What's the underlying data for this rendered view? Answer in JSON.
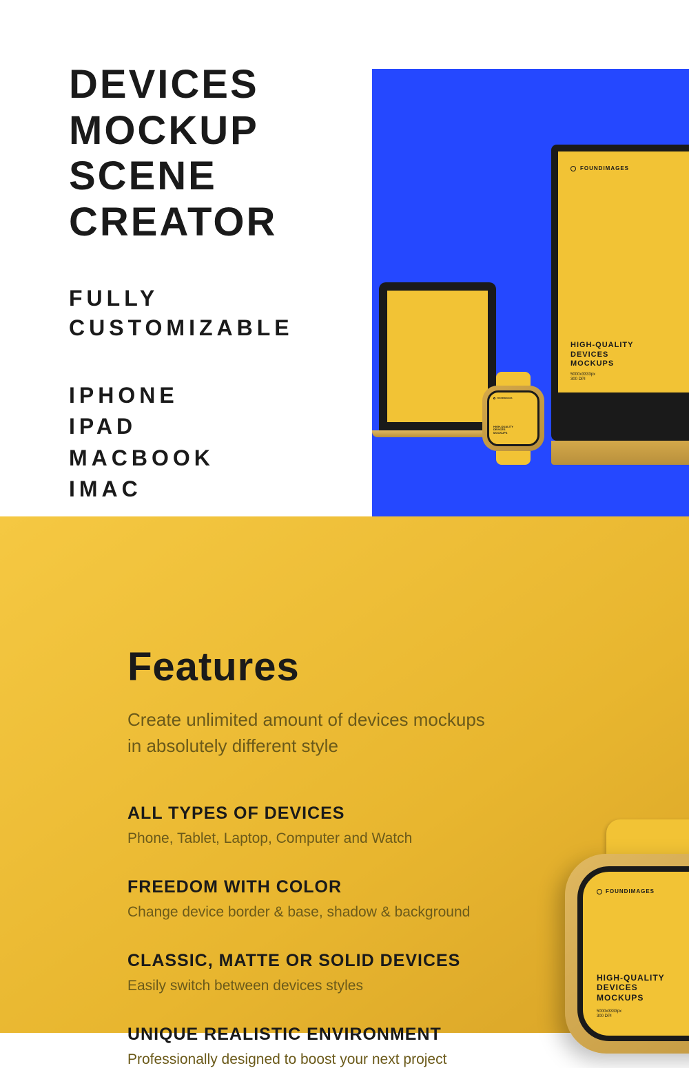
{
  "hero": {
    "title_line1": "DEVICES",
    "title_line2": "MOCKUP",
    "title_line3": "SCENE",
    "title_line4": "CREATOR",
    "subtitle_line1": "FULLY",
    "subtitle_line2": "CUSTOMIZABLE",
    "devices": [
      "IPHONE",
      "IPAD",
      "MACBOOK",
      "IMAC"
    ]
  },
  "brand": "FOUNDIMAGES",
  "screen_content": {
    "title_line1": "HIGH-QUALITY",
    "title_line2": "DEVICES",
    "title_line3": "MOCKUPS",
    "meta_line1": "5000x3333px",
    "meta_line2": "300 DPI"
  },
  "features": {
    "title": "Features",
    "subtitle_line1": "Create unlimited amount of devices mockups",
    "subtitle_line2": "in absolutely different style",
    "items": [
      {
        "heading": "ALL TYPES OF DEVICES",
        "desc": "Phone, Tablet, Laptop, Computer and Watch"
      },
      {
        "heading": "FREEDOM WITH COLOR",
        "desc": "Change device border & base, shadow & background"
      },
      {
        "heading": "CLASSIC, MATTE OR SOLID DEVICES",
        "desc": "Easily switch between devices styles"
      },
      {
        "heading": "UNIQUE REALISTIC ENVIRONMENT",
        "desc": "Professionally designed to boost your next project"
      }
    ]
  }
}
